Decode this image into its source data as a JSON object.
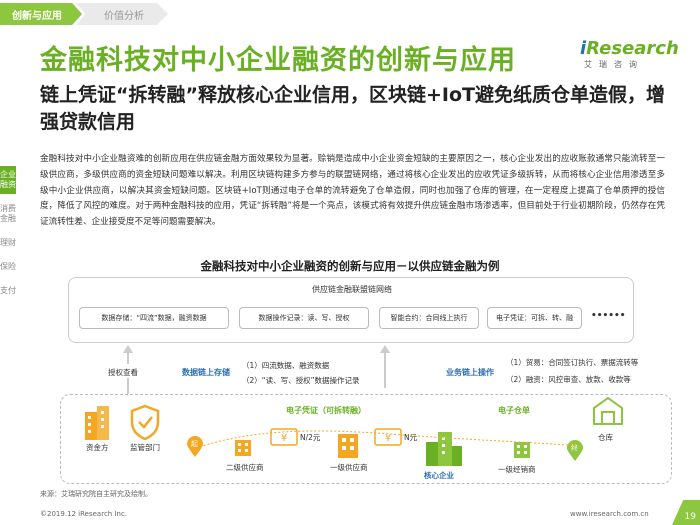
{
  "header": {
    "tab_active": "创新与应用",
    "tab_inactive": "价值分析"
  },
  "title": "金融科技对中小企业融资的创新与应用",
  "logo": {
    "main_i": "i",
    "main_rest": "Research",
    "sub": "艾瑞咨询"
  },
  "subtitle": "链上凭证“拆转融”释放核心企业信用，区块链+IoT避免纸质仓单造假，增强贷款信用",
  "sidebar": [
    {
      "label": "企业融资",
      "active": true
    },
    {
      "label": "消费金融",
      "active": false
    },
    {
      "label": "理财",
      "active": false
    },
    {
      "label": "保险",
      "active": false
    },
    {
      "label": "支付",
      "active": false
    }
  ],
  "body_text": "金融科技对中小企业融资难的创新应用在供应链金融方面效果较为显著。赊销是造成中小企业资金短缺的主要原因之一，核心企业发出的应收账款通常只能流转至一级供应商，多级供应商的资金短缺问题难以解决。利用区块链构建多方参与的联盟链网络，通过将核心企业发出的应收凭证多级拆转，从而将核心企业信用渗透至多级中小企业供应商，以解决其资金短缺问题。区块链+IoT则通过电子仓单的流转避免了仓单造假，同时也加强了仓库的管理，在一定程度上提高了仓单质押的授信度，降低了风控的难度。对于两种金融科技的应用，凭证“拆转融”将是一个亮点，该模式将有效提升供应链金融市场渗透率，但目前处于行业初期阶段，仍然存在凭证流转性差、企业接受度不足等问题需要解决。",
  "diagram": {
    "title": "金融科技对中小企业融资的创新与应用－以供应链金融为例",
    "network_label": "供应链金融联盟链网络",
    "network_items": [
      "数据存储：“四流”数据，融资数据",
      "数据操作记录：读、写、授权",
      "智能合约：合同线上执行",
      "电子凭证：可拆、转、融"
    ],
    "network_more": "••••••",
    "auth_label": "授权查看",
    "data_onchain": "数据链上存储",
    "data_notes": [
      "（1）四流数据、融资数据",
      "（2）“读、写、授权”数据操作记录"
    ],
    "biz_onchain": "业务链上操作",
    "biz_notes": [
      "（1）贸易：合同签订执行、票据流转等",
      "（2）融资：风控审查、放款、收款等"
    ],
    "evoucher_label": "电子凭证（可拆转融）",
    "ereceipt_label": "电子仓单",
    "nodes": {
      "funder": "资金方",
      "regulator": "监管部门",
      "tier2": "二级供应商",
      "tier1": "一级供应商",
      "core": "核心企业",
      "distributor": "一级经销商",
      "warehouse": "仓库"
    },
    "amounts": [
      "N/2元",
      "N元"
    ],
    "pins": [
      "起",
      "终"
    ]
  },
  "footer": {
    "source": "来源：艾瑞研究院自主研究及绘制。",
    "copyright": "©2019.12 iResearch Inc.",
    "url": "www.iresearch.com.cn",
    "page": "19"
  },
  "colors": {
    "green": "#6ab023",
    "blue": "#2f6fb3",
    "orange": "#f5a623"
  }
}
